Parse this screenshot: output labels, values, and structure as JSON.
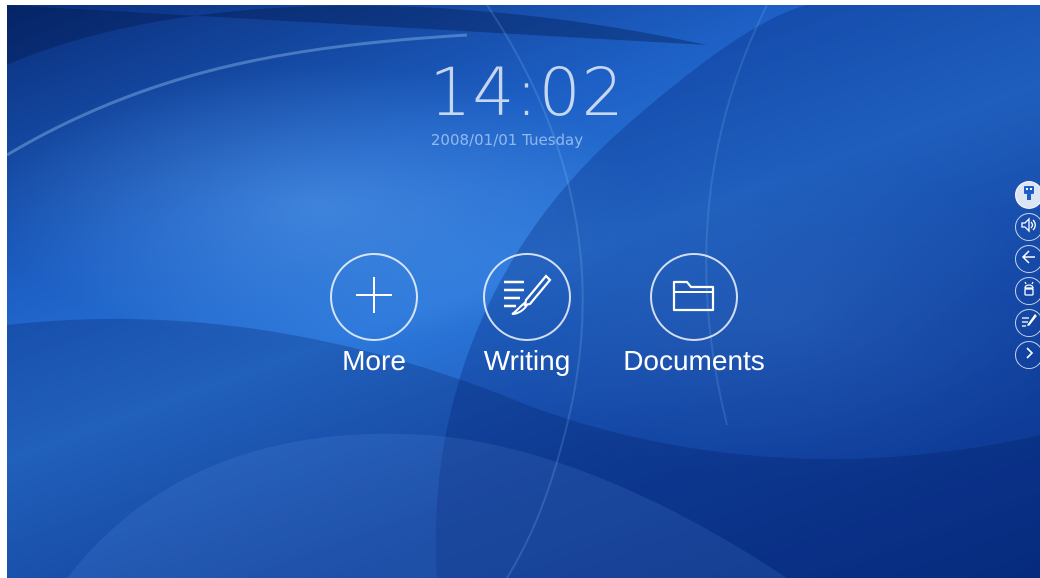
{
  "home": {
    "clock": {
      "time": "14:02",
      "date": "2008/01/01 Tuesday"
    },
    "apps": [
      {
        "label": "More",
        "icon": "plus-icon"
      },
      {
        "label": "Writing",
        "icon": "writing-brush-icon"
      },
      {
        "label": "Documents",
        "icon": "folder-icon"
      }
    ]
  },
  "side_toolbar": {
    "buttons": [
      {
        "icon": "usb-icon",
        "active": true
      },
      {
        "icon": "volume-icon"
      },
      {
        "icon": "back-icon"
      },
      {
        "icon": "android-icon"
      },
      {
        "icon": "annotate-icon"
      },
      {
        "icon": "next-icon"
      }
    ]
  },
  "colors": {
    "background_dark": "#0a2e7a",
    "background_mid": "#2c78db",
    "foreground": "#ffffff"
  }
}
